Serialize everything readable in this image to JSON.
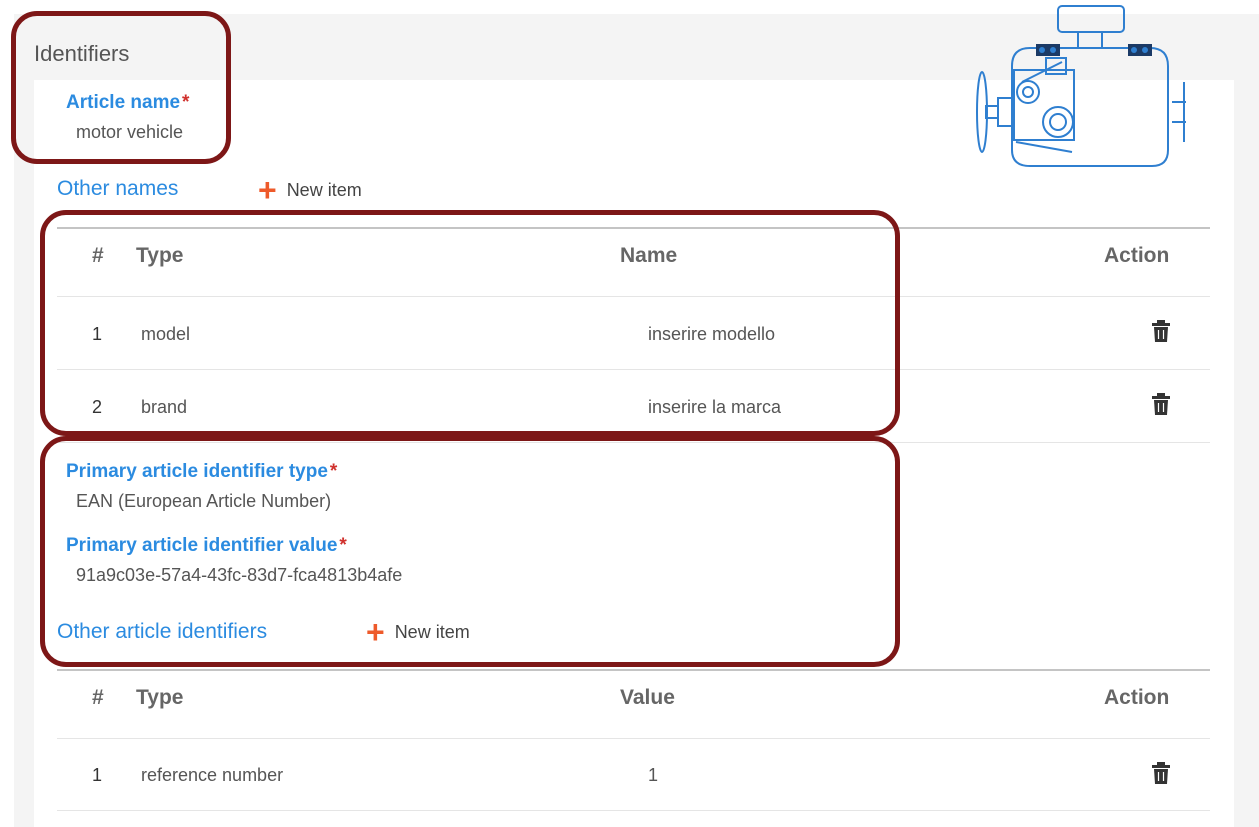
{
  "section": {
    "title": "Identifiers"
  },
  "article_name": {
    "label": "Article name",
    "required_mark": "*",
    "value": "motor vehicle"
  },
  "other_names": {
    "label": "Other names",
    "add_label": "New item",
    "columns": {
      "num": "#",
      "type": "Type",
      "name": "Name",
      "action": "Action"
    },
    "rows": [
      {
        "num": "1",
        "type": "model",
        "name": "inserire modello"
      },
      {
        "num": "2",
        "type": "brand",
        "name": "inserire la marca"
      }
    ]
  },
  "primary_type": {
    "label": "Primary article identifier type",
    "required_mark": "*",
    "value": "EAN (European Article Number)"
  },
  "primary_value": {
    "label": "Primary article identifier value",
    "required_mark": "*",
    "value": "91a9c03e-57a4-43fc-83d7-fca4813b4afe"
  },
  "other_identifiers": {
    "label": "Other article identifiers",
    "add_label": "New item",
    "columns": {
      "num": "#",
      "type": "Type",
      "value": "Value",
      "action": "Action"
    },
    "rows": [
      {
        "num": "1",
        "type": "reference number",
        "value": "1"
      }
    ]
  },
  "colors": {
    "accent": "#2b8be0",
    "add": "#ee5a2a",
    "required": "#d0312d",
    "highlight": "#7d1717"
  },
  "icons": {
    "delete": "trash-icon",
    "add": "plus-icon",
    "illustration": "engine-illustration"
  }
}
